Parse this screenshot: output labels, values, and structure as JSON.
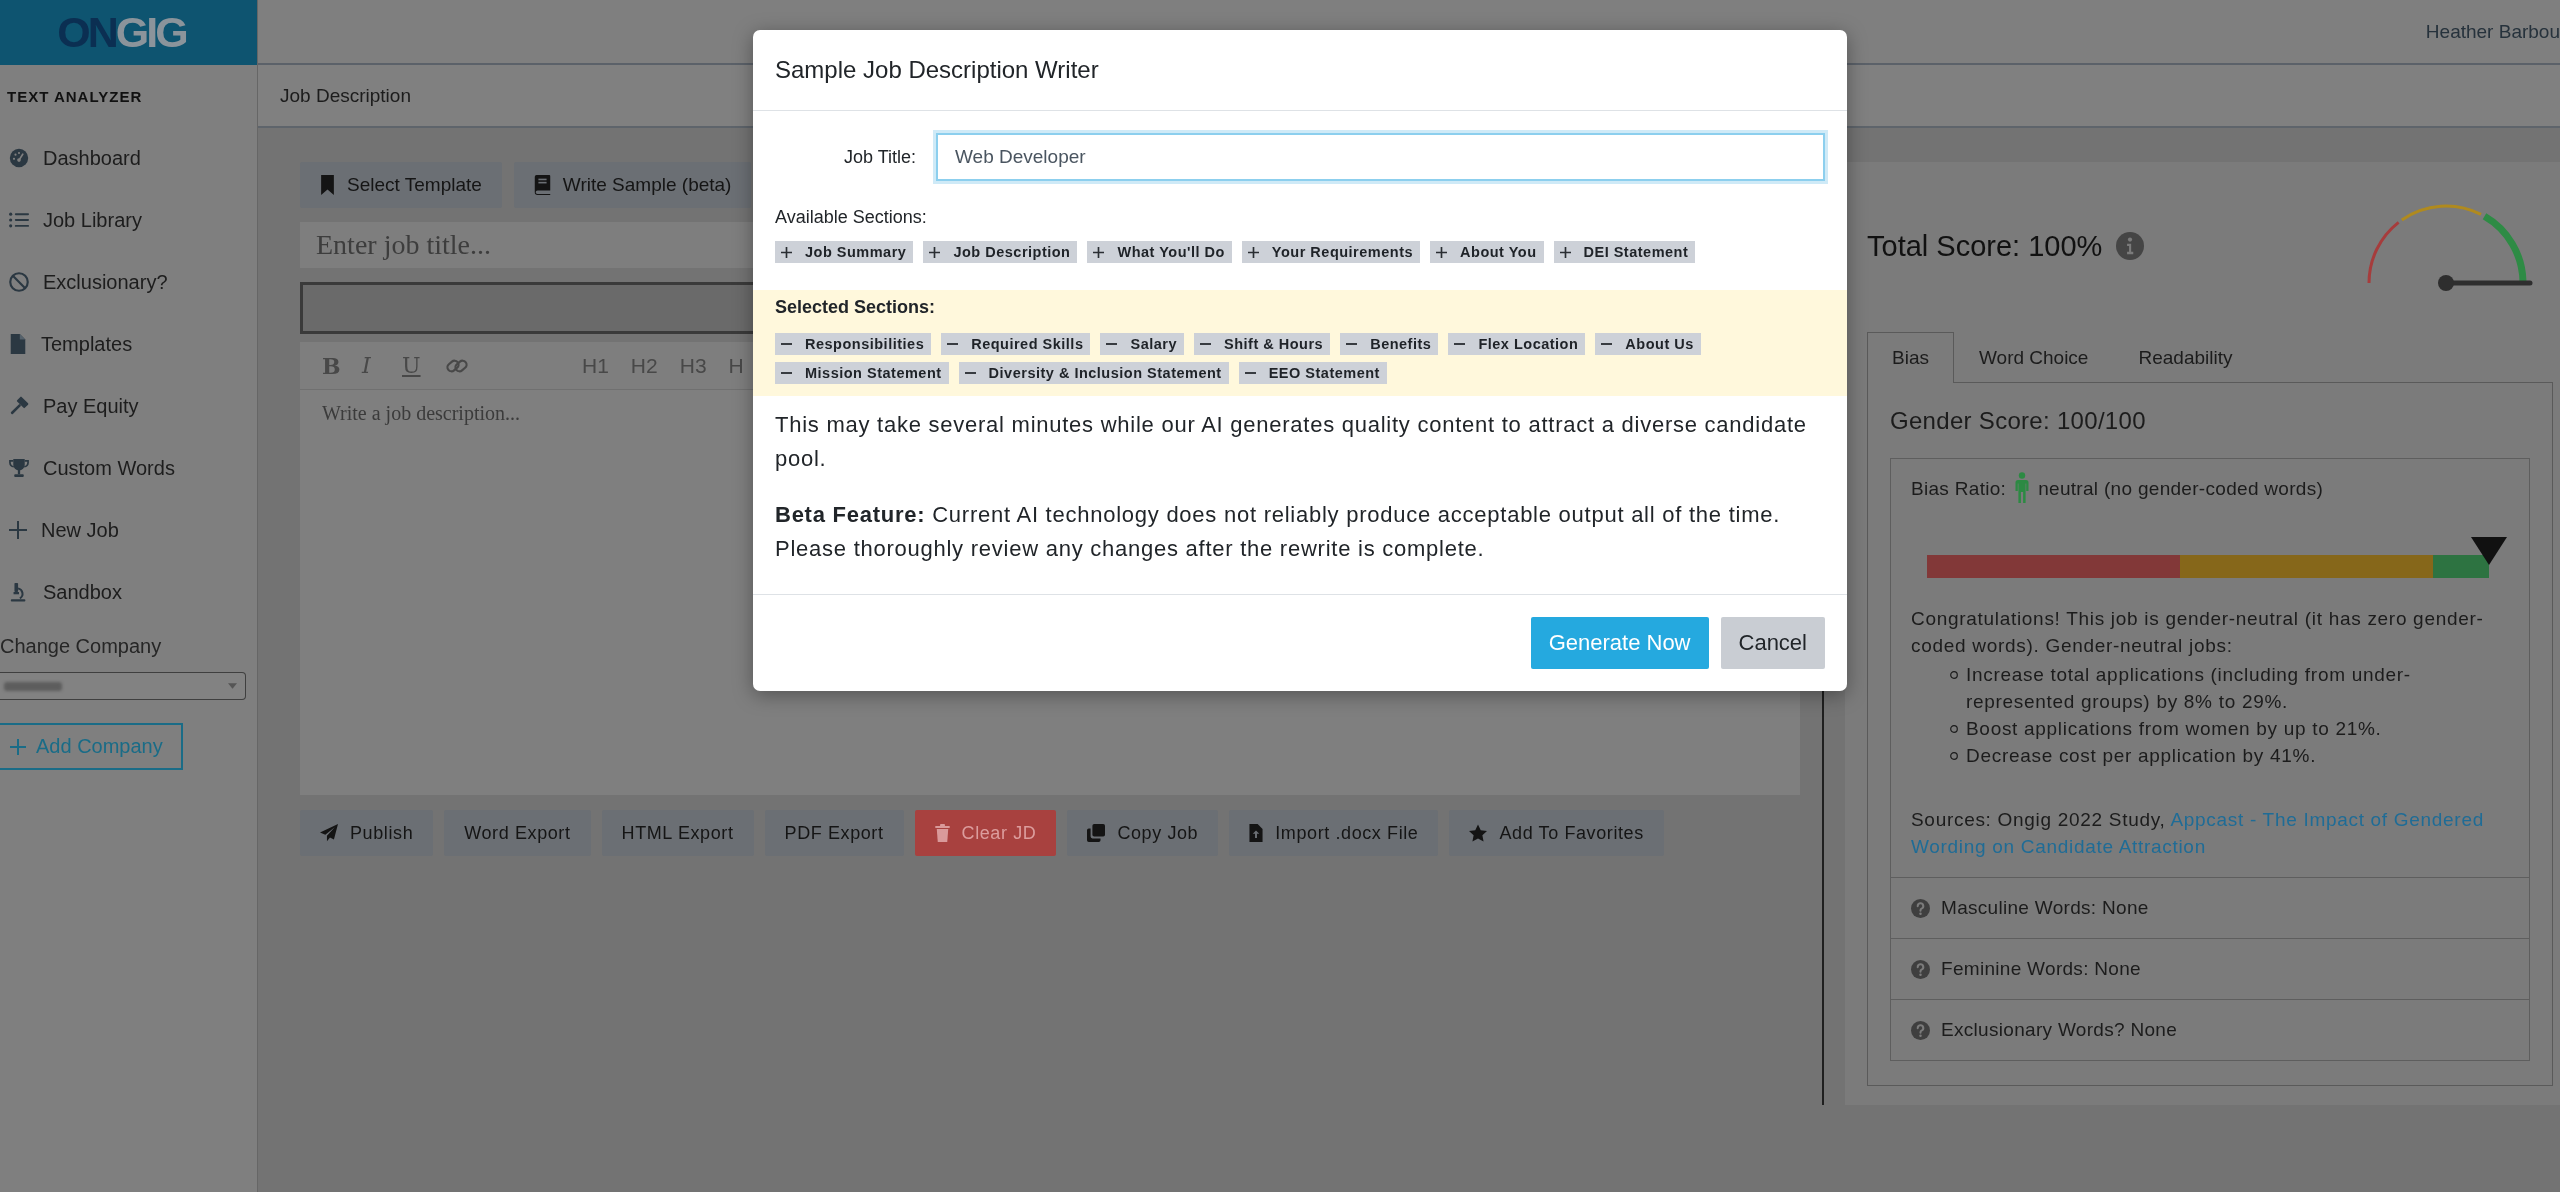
{
  "logo": [
    "ON",
    "GIG"
  ],
  "header": {
    "user_name": "Heather Barbou"
  },
  "sidebar": {
    "heading": "TEXT ANALYZER",
    "items": [
      "Dashboard",
      "Job Library",
      "Exclusionary?",
      "Templates",
      "Pay Equity",
      "Custom Words",
      "New Job",
      "Sandbox"
    ],
    "company_label": "Change Company",
    "add_company": "Add Company"
  },
  "page_title": "Job Description",
  "editor": {
    "top_buttons": [
      "Select Template",
      "Write Sample (beta)"
    ],
    "title_placeholder": "Enter job title...",
    "format_buttons": [
      {
        "label": "B",
        "kind": "bold"
      },
      {
        "label": "I",
        "kind": "italic"
      },
      {
        "label": "U",
        "kind": "underline"
      }
    ],
    "heading_buttons": [
      "H1",
      "H2",
      "H3",
      "H"
    ],
    "body_placeholder": "Write a job description...",
    "actions": [
      {
        "label": "Publish",
        "kind": "default"
      },
      {
        "label": "Word Export",
        "kind": "default"
      },
      {
        "label": "HTML Export",
        "kind": "default"
      },
      {
        "label": "PDF Export",
        "kind": "default"
      },
      {
        "label": "Clear JD",
        "kind": "danger"
      },
      {
        "label": "Copy Job",
        "kind": "default"
      },
      {
        "label": "Import .docx File",
        "kind": "default"
      },
      {
        "label": "Add To Favorites",
        "kind": "default"
      }
    ]
  },
  "score": {
    "title": "Total Score: 100%"
  },
  "tabs": [
    {
      "label": "Bias",
      "selected": true
    },
    {
      "label": "Word Choice",
      "selected": false
    },
    {
      "label": "Readability",
      "selected": false
    }
  ],
  "bias": {
    "heading": "Gender Score: 100/100",
    "ratio_label": "Bias Ratio:",
    "ratio_value": "neutral (no gender-coded words)",
    "meter": {
      "level": 1
    },
    "summary": "Congratulations! This job is gender-neutral (it has zero gender-coded words). Gender-neutral jobs:",
    "benefits": [
      "Increase total applications (including from under-represented groups) by 8% to 29%.",
      "Boost applications from women by up to 21%.",
      "Decrease cost per application by 41%."
    ],
    "sources": {
      "text": "Sources: Ongig 2022 Study,",
      "link": [
        "Appcast - The Impact of Gendered",
        "Wording on Candidate Attraction"
      ]
    },
    "word_counts": [
      "Masculine Words: None",
      "Feminine Words: None",
      "Exclusionary Words? None"
    ]
  },
  "modal": {
    "title": "Sample Job Description Writer",
    "job_title_label": "Job Title:",
    "job_title_value": "Web Developer",
    "available_label": "Available Sections:",
    "available_sections": [
      "Job Summary",
      "Job Description",
      "What You'll Do",
      "Your Requirements",
      "About You",
      "DEI Statement"
    ],
    "selected_label": "Selected Sections:",
    "selected_sections": [
      "Responsibilities",
      "Required Skills",
      "Salary",
      "Shift & Hours",
      "Benefits",
      "Flex Location",
      "About Us",
      "Mission Statement",
      "Diversity & Inclusion Statement",
      "EEO Statement"
    ],
    "notice": "This may take several minutes while our AI generates quality content to attract a diverse candidate pool.",
    "beta_notice": "**Beta Feature:** Current AI technology does not reliably produce acceptable output all of the time. Please thoroughly review any changes after the rewrite is complete.",
    "buttons": [
      {
        "label": "Generate Now",
        "kind": "primary"
      },
      {
        "label": "Cancel",
        "kind": "secondary"
      }
    ]
  }
}
